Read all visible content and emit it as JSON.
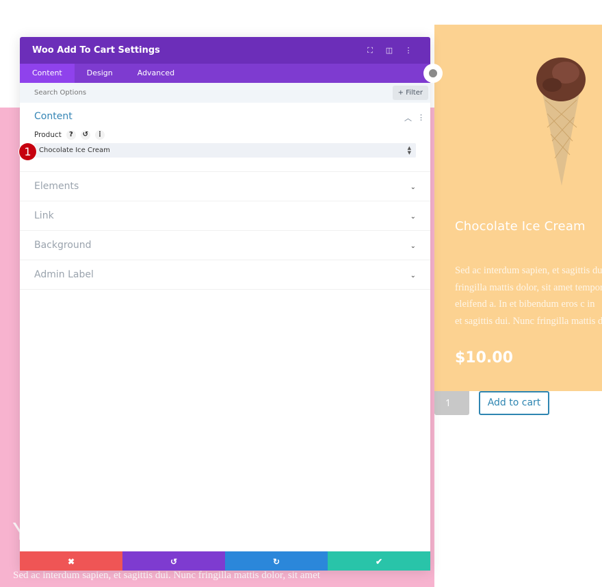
{
  "modal": {
    "title": "Woo Add To Cart Settings",
    "header_icons": [
      "expand-icon",
      "split-view-icon",
      "more-icon"
    ],
    "tabs": [
      {
        "label": "Content",
        "active": true
      },
      {
        "label": "Design",
        "active": false
      },
      {
        "label": "Advanced",
        "active": false
      }
    ],
    "search": {
      "placeholder": "Search Options",
      "value": ""
    },
    "filter_label": "+ Filter",
    "content_section": {
      "title": "Content",
      "field_label": "Product",
      "help_icon": "?",
      "reset_icon": "↺",
      "more_icon": "⋮",
      "selected_product": "Chocolate Ice Cream"
    },
    "sections": [
      {
        "title": "Elements"
      },
      {
        "title": "Link"
      },
      {
        "title": "Background"
      },
      {
        "title": "Admin Label"
      }
    ],
    "step_badge": "1",
    "footer": {
      "cancel_icon": "✖",
      "undo_icon": "↺",
      "redo_icon": "↻",
      "save_icon": "✔"
    }
  },
  "product": {
    "title": "Chocolate Ice Cream",
    "description_lines": [
      "Sed ac interdum sapien, et sagittis dui.",
      "fringilla mattis dolor, sit amet tempor",
      "eleifend a. In et bibendum eros c in",
      "et sagittis dui. Nunc fringilla mattis dolor"
    ],
    "price": "$10.00",
    "quantity": "1",
    "add_to_cart_label": "Add to cart"
  },
  "page": {
    "heading_partial": "Y",
    "body_text": "Sed ac interdum sapien, et sagittis dui. Nunc fringilla mattis dolor, sit amet"
  },
  "colors": {
    "header_purple": "#6c2eb9",
    "tab_purple": "#7e3bd0",
    "pink_bg": "#f7b3cf",
    "card_bg": "#fcd291",
    "cancel": "#ef5555",
    "redo": "#2b87da",
    "save": "#29c4a9"
  }
}
